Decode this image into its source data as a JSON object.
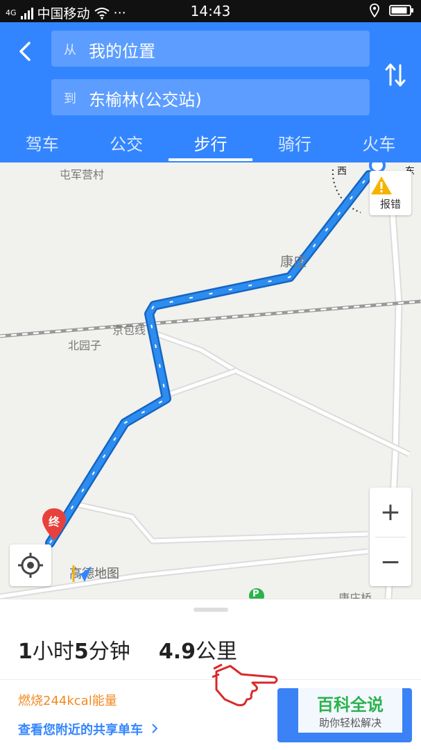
{
  "status_bar": {
    "network": "4G",
    "carrier": "中国移动",
    "more": "···",
    "time": "14:43"
  },
  "header": {
    "from_prefix": "从",
    "from_value": "我的位置",
    "to_prefix": "到",
    "to_value": "东榆林(公交站)",
    "tabs": [
      "驾车",
      "公交",
      "步行",
      "骑行",
      "火车"
    ],
    "active_tab": "步行"
  },
  "map": {
    "labels": {
      "village": "屯军营村",
      "kangzhuang": "康庄",
      "railway": "京包线",
      "beiyuanzi": "北园子",
      "bottom_partial": "康庄桥"
    },
    "compass_partial": [
      "西",
      "东"
    ],
    "report_label": "报错",
    "end_marker": "终",
    "zoom_in": "+",
    "zoom_out": "−",
    "logo_text": "高德地图",
    "parking": "P",
    "colors": {
      "route": "#2d8cf0",
      "route_outline": "#1565c0",
      "end_marker": "#e8413c"
    }
  },
  "panel": {
    "duration_h": "1",
    "duration_h_unit": "小时",
    "duration_m": "5",
    "duration_m_unit": "分钟",
    "distance": "4.9",
    "distance_unit": "公里",
    "calories": "燃烧244kcal能量",
    "shared_bike": "查看您附近的共享单车",
    "watermark_title": "百科全说",
    "watermark_sub": "助你轻松解决"
  },
  "colors": {
    "header_bg": "#3385ff",
    "field_bg": "#5c9dff",
    "calorie_text": "#f08a24",
    "link_text": "#3385ff"
  }
}
